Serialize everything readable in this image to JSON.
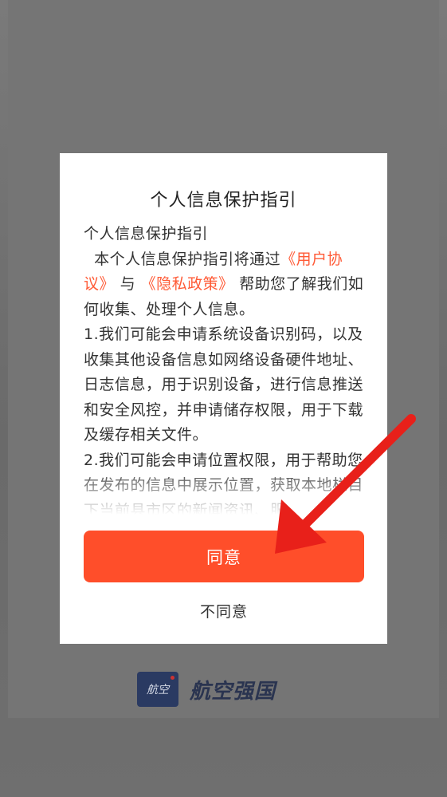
{
  "dialog": {
    "title": "个人信息保护指引",
    "heading": "个人信息保护指引",
    "intro_prefix": "本个人信息保护指引将通过",
    "link_user_agreement": "《用户协议》",
    "intro_and": "与",
    "link_privacy_policy": "《隐私政策》",
    "intro_suffix": "帮助您了解我们如何收集、处理个人信息。",
    "item1": "1.我们可能会申请系统设备识别码，以及收集其他设备信息如网络设备硬件地址、日志信息，用于识别设备，进行信息推送和安全风控，并申请储存权限，用于下载及缓存相关文件。",
    "item2": "2.我们可能会申请位置权限，用于帮助您在发布的信息中展示位置，获取本地栏目下当前县市区的新闻资讯、服",
    "agree_label": "同意",
    "disagree_label": "不同意"
  },
  "brand": {
    "logo_text": "航空",
    "name": "航空强国"
  },
  "colors": {
    "accent": "#ff4e2a",
    "link": "#ff5a36",
    "overlay": "#6e6e6e",
    "arrow": "#e8201a"
  }
}
